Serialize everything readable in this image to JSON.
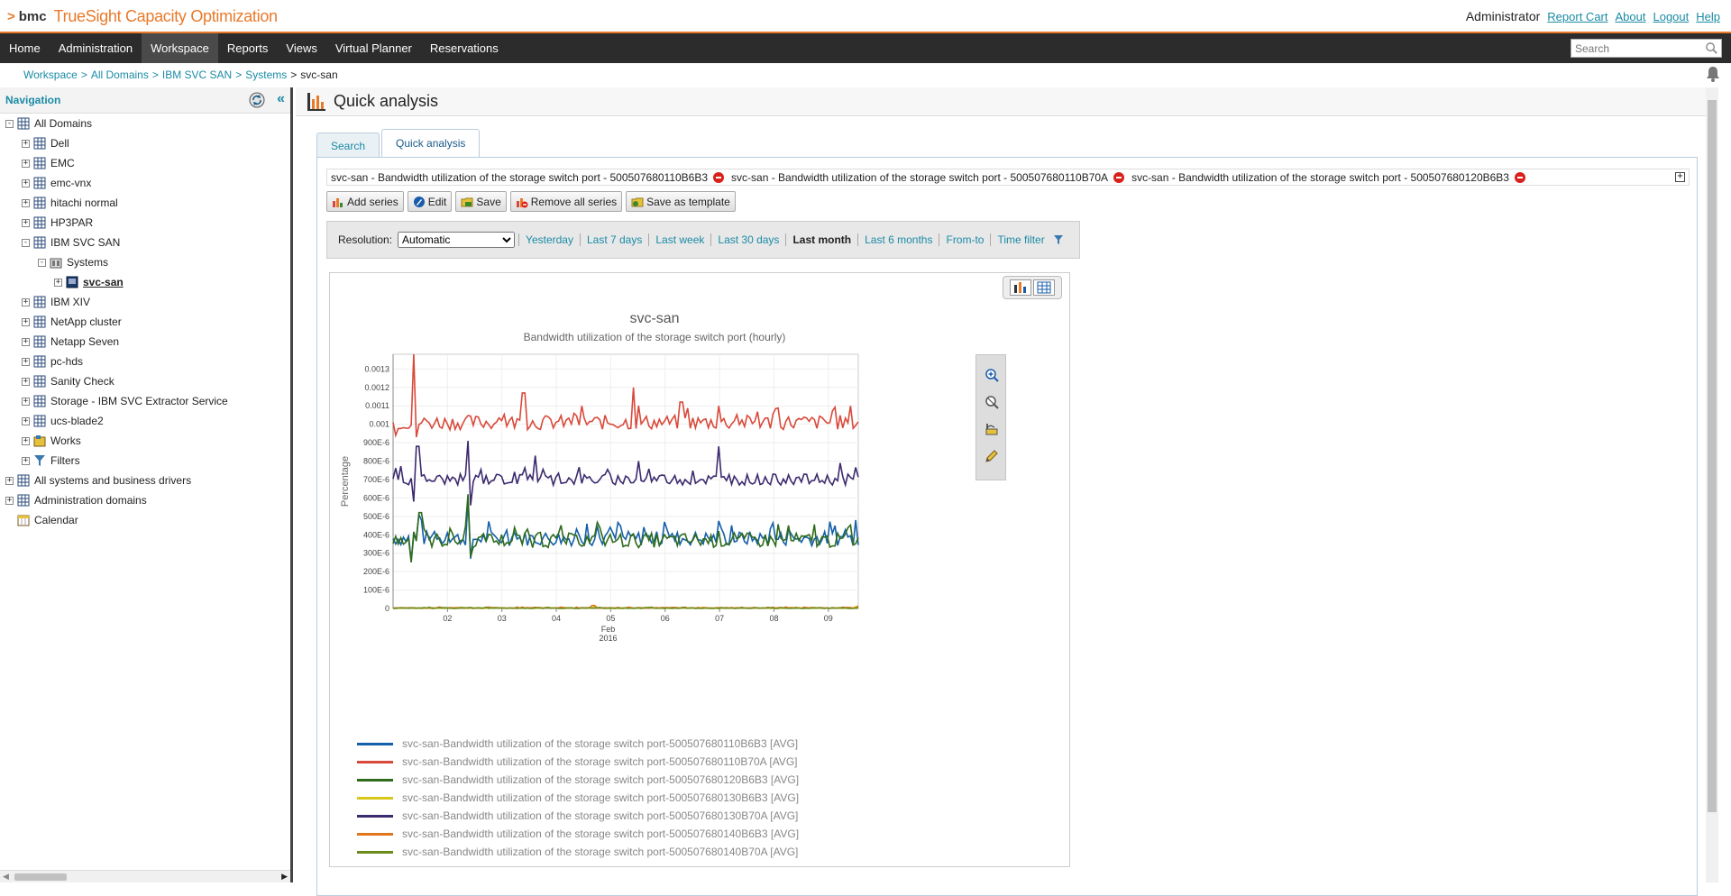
{
  "app": {
    "brand": "bmc",
    "product": "TrueSight Capacity Optimization",
    "user": "Administrator",
    "links": [
      "Report Cart",
      "About",
      "Logout",
      "Help"
    ]
  },
  "menu": {
    "items": [
      "Home",
      "Administration",
      "Workspace",
      "Reports",
      "Views",
      "Virtual Planner",
      "Reservations"
    ],
    "active": "Workspace",
    "search_placeholder": "Search"
  },
  "breadcrumb": {
    "items": [
      "Workspace",
      "All Domains",
      "IBM SVC SAN",
      "Systems"
    ],
    "current": "svc-san"
  },
  "navigation": {
    "title": "Navigation",
    "tree": [
      {
        "label": "All Domains",
        "exp": "-"
      },
      {
        "label": "Dell",
        "exp": "+"
      },
      {
        "label": "EMC",
        "exp": "+"
      },
      {
        "label": "emc-vnx",
        "exp": "+"
      },
      {
        "label": "hitachi normal",
        "exp": "+"
      },
      {
        "label": "HP3PAR",
        "exp": "+"
      },
      {
        "label": "IBM SVC SAN",
        "exp": "-"
      },
      {
        "label": "Systems",
        "exp": "-"
      },
      {
        "label": "svc-san",
        "exp": "+"
      },
      {
        "label": "IBM XIV",
        "exp": "+"
      },
      {
        "label": "NetApp cluster",
        "exp": "+"
      },
      {
        "label": "Netapp Seven",
        "exp": "+"
      },
      {
        "label": "pc-hds",
        "exp": "+"
      },
      {
        "label": "Sanity Check",
        "exp": "+"
      },
      {
        "label": "Storage - IBM SVC Extractor Service",
        "exp": "+"
      },
      {
        "label": "ucs-blade2",
        "exp": "+"
      },
      {
        "label": "Works",
        "exp": "+"
      },
      {
        "label": "Filters",
        "exp": "+"
      },
      {
        "label": "All systems and business drivers",
        "exp": "+"
      },
      {
        "label": "Administration domains",
        "exp": "+"
      },
      {
        "label": "Calendar",
        "exp": ""
      }
    ]
  },
  "page": {
    "title": "Quick analysis",
    "tabs": [
      "Search",
      "Quick analysis"
    ],
    "active_tab": "Quick analysis"
  },
  "series_bar": {
    "items": [
      "svc-san - Bandwidth utilization of the storage switch port - 500507680110B6B3",
      "svc-san - Bandwidth utilization of the storage switch port - 500507680110B70A",
      "svc-san - Bandwidth utilization of the storage switch port - 500507680120B6B3"
    ]
  },
  "toolbar": {
    "add": "Add series",
    "edit": "Edit",
    "save": "Save",
    "remove_all": "Remove all series",
    "save_template": "Save as template"
  },
  "filter": {
    "resolution_label": "Resolution:",
    "resolution_value": "Automatic",
    "ranges": [
      "Yesterday",
      "Last 7 days",
      "Last week",
      "Last 30 days",
      "Last month",
      "Last 6 months",
      "From-to",
      "Time filter"
    ],
    "selected": "Last month"
  },
  "chart_data": {
    "type": "line",
    "title": "svc-san",
    "subtitle": "Bandwidth utilization of the storage switch port (hourly)",
    "ylabel": "Percentage",
    "xlabel": "",
    "x_ticks": [
      "02",
      "03",
      "04",
      "05",
      "06",
      "07",
      "08",
      "09"
    ],
    "x_month": "Feb",
    "x_year": "2016",
    "y_ticks": [
      "0",
      "100E-6",
      "200E-6",
      "300E-6",
      "400E-6",
      "500E-6",
      "600E-6",
      "700E-6",
      "800E-6",
      "900E-6",
      "0.001",
      "0.0011",
      "0.0012",
      "0.0013"
    ],
    "ylim": [
      0,
      0.00138
    ],
    "xlim": [
      1.0,
      9.55
    ],
    "colors": [
      "#1460aa",
      "#d9493a",
      "#2e6b1a",
      "#d8c81a",
      "#3c2a6e",
      "#e0761a",
      "#6a8a1a"
    ],
    "series": [
      {
        "name": "svc-san-Bandwidth utilization of the storage switch port-500507680110B6B3 [AVG]",
        "base": 0.00038,
        "spread": 4e-05,
        "spikes": [
          [
            1.35,
            0.00026
          ],
          [
            1.48,
            0.00051
          ],
          [
            2.37,
            0.00059
          ],
          [
            2.42,
            0.00027
          ],
          [
            4.55,
            0.00046
          ],
          [
            6.0,
            0.00047
          ],
          [
            9.5,
            0.00048
          ]
        ]
      },
      {
        "name": "svc-san-Bandwidth utilization of the storage switch port-500507680110B70A [AVG]",
        "base": 0.00101,
        "spread": 4e-05,
        "spikes": [
          [
            1.38,
            0.00138
          ],
          [
            1.05,
            0.00094
          ],
          [
            1.43,
            0.00093
          ],
          [
            3.4,
            0.00117
          ],
          [
            5.4,
            0.0012
          ],
          [
            6.3,
            0.00112
          ],
          [
            7.0,
            0.0011
          ],
          [
            9.4,
            0.0011
          ]
        ]
      },
      {
        "name": "svc-san-Bandwidth utilization of the storage switch port-500507680120B6B3 [AVG]",
        "base": 0.00037,
        "spread": 4e-05,
        "spikes": [
          [
            1.35,
            0.00025
          ],
          [
            1.5,
            0.00052
          ],
          [
            2.4,
            0.00062
          ],
          [
            2.44,
            0.00028
          ],
          [
            4.8,
            0.00044
          ],
          [
            7.0,
            0.00042
          ],
          [
            9.6,
            0.00032
          ]
        ]
      },
      {
        "name": "svc-san-Bandwidth utilization of the storage switch port-500507680130B6B3 [AVG]",
        "base": 2e-06,
        "spread": 2e-06,
        "spikes": [
          [
            4.7,
            1.2e-05
          ],
          [
            9.5,
            1e-05
          ]
        ]
      },
      {
        "name": "svc-san-Bandwidth utilization of the storage switch port-500507680130B70A [AVG]",
        "base": 0.0007,
        "spread": 3e-05,
        "spikes": [
          [
            1.4,
            0.00058
          ],
          [
            1.45,
            0.00088
          ],
          [
            2.37,
            0.00091
          ],
          [
            2.42,
            0.00056
          ],
          [
            3.6,
            0.00083
          ],
          [
            5.5,
            0.0008
          ],
          [
            7.0,
            0.00088
          ],
          [
            9.2,
            0.00079
          ]
        ]
      },
      {
        "name": "svc-san-Bandwidth utilization of the storage switch port-500507680140B6B3 [AVG]",
        "base": 3e-06,
        "spread": 2e-06,
        "spikes": [
          [
            4.68,
            1.6e-05
          ],
          [
            9.55,
            1.4e-05
          ]
        ]
      },
      {
        "name": "svc-san-Bandwidth utilization of the storage switch port-500507680140B70A [AVG]",
        "base": 2e-06,
        "spread": 2e-06,
        "spikes": []
      }
    ]
  }
}
